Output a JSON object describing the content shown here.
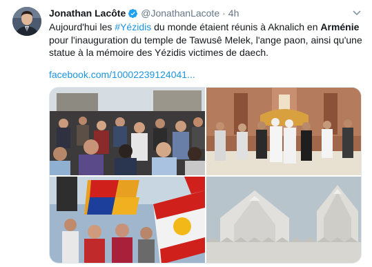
{
  "tweet": {
    "author_name": "Jonathan Lacôte",
    "handle": "@JonathanLacote",
    "separator": "·",
    "time": "4h",
    "text": {
      "p1": "Aujourd'hui les ",
      "hashtag": "#Yézidis",
      "p2": " du monde étaient réunis à Aknalich en ",
      "bold": "Arménie",
      "p3": " pour l'inauguration du temple de Tawusê Melek, l'ange paon, ainsi qu'une statue à la mémoire des Yézidis victimes de daech."
    },
    "link": "facebook.com/10002239124041..."
  },
  "icons": {
    "verified": "verified-badge-icon",
    "caret": "chevron-down-icon"
  },
  "colors": {
    "link_blue": "#1b95e0",
    "verified_blue": "#1da1f2",
    "secondary_text": "#657786"
  }
}
